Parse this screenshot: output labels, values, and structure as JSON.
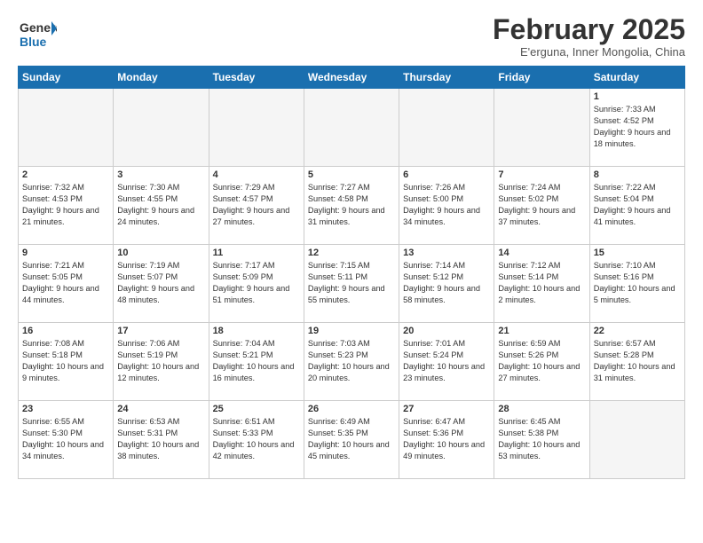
{
  "header": {
    "logo_line1": "General",
    "logo_line2": "Blue",
    "month": "February 2025",
    "location": "E'erguna, Inner Mongolia, China"
  },
  "weekdays": [
    "Sunday",
    "Monday",
    "Tuesday",
    "Wednesday",
    "Thursday",
    "Friday",
    "Saturday"
  ],
  "weeks": [
    [
      {
        "day": "",
        "empty": true
      },
      {
        "day": "",
        "empty": true
      },
      {
        "day": "",
        "empty": true
      },
      {
        "day": "",
        "empty": true
      },
      {
        "day": "",
        "empty": true
      },
      {
        "day": "",
        "empty": true
      },
      {
        "day": "1",
        "sunrise": "7:33 AM",
        "sunset": "4:52 PM",
        "daylight": "9 hours and 18 minutes."
      }
    ],
    [
      {
        "day": "2",
        "sunrise": "7:32 AM",
        "sunset": "4:53 PM",
        "daylight": "9 hours and 21 minutes."
      },
      {
        "day": "3",
        "sunrise": "7:30 AM",
        "sunset": "4:55 PM",
        "daylight": "9 hours and 24 minutes."
      },
      {
        "day": "4",
        "sunrise": "7:29 AM",
        "sunset": "4:57 PM",
        "daylight": "9 hours and 27 minutes."
      },
      {
        "day": "5",
        "sunrise": "7:27 AM",
        "sunset": "4:58 PM",
        "daylight": "9 hours and 31 minutes."
      },
      {
        "day": "6",
        "sunrise": "7:26 AM",
        "sunset": "5:00 PM",
        "daylight": "9 hours and 34 minutes."
      },
      {
        "day": "7",
        "sunrise": "7:24 AM",
        "sunset": "5:02 PM",
        "daylight": "9 hours and 37 minutes."
      },
      {
        "day": "8",
        "sunrise": "7:22 AM",
        "sunset": "5:04 PM",
        "daylight": "9 hours and 41 minutes."
      }
    ],
    [
      {
        "day": "9",
        "sunrise": "7:21 AM",
        "sunset": "5:05 PM",
        "daylight": "9 hours and 44 minutes."
      },
      {
        "day": "10",
        "sunrise": "7:19 AM",
        "sunset": "5:07 PM",
        "daylight": "9 hours and 48 minutes."
      },
      {
        "day": "11",
        "sunrise": "7:17 AM",
        "sunset": "5:09 PM",
        "daylight": "9 hours and 51 minutes."
      },
      {
        "day": "12",
        "sunrise": "7:15 AM",
        "sunset": "5:11 PM",
        "daylight": "9 hours and 55 minutes."
      },
      {
        "day": "13",
        "sunrise": "7:14 AM",
        "sunset": "5:12 PM",
        "daylight": "9 hours and 58 minutes."
      },
      {
        "day": "14",
        "sunrise": "7:12 AM",
        "sunset": "5:14 PM",
        "daylight": "10 hours and 2 minutes."
      },
      {
        "day": "15",
        "sunrise": "7:10 AM",
        "sunset": "5:16 PM",
        "daylight": "10 hours and 5 minutes."
      }
    ],
    [
      {
        "day": "16",
        "sunrise": "7:08 AM",
        "sunset": "5:18 PM",
        "daylight": "10 hours and 9 minutes."
      },
      {
        "day": "17",
        "sunrise": "7:06 AM",
        "sunset": "5:19 PM",
        "daylight": "10 hours and 12 minutes."
      },
      {
        "day": "18",
        "sunrise": "7:04 AM",
        "sunset": "5:21 PM",
        "daylight": "10 hours and 16 minutes."
      },
      {
        "day": "19",
        "sunrise": "7:03 AM",
        "sunset": "5:23 PM",
        "daylight": "10 hours and 20 minutes."
      },
      {
        "day": "20",
        "sunrise": "7:01 AM",
        "sunset": "5:24 PM",
        "daylight": "10 hours and 23 minutes."
      },
      {
        "day": "21",
        "sunrise": "6:59 AM",
        "sunset": "5:26 PM",
        "daylight": "10 hours and 27 minutes."
      },
      {
        "day": "22",
        "sunrise": "6:57 AM",
        "sunset": "5:28 PM",
        "daylight": "10 hours and 31 minutes."
      }
    ],
    [
      {
        "day": "23",
        "sunrise": "6:55 AM",
        "sunset": "5:30 PM",
        "daylight": "10 hours and 34 minutes."
      },
      {
        "day": "24",
        "sunrise": "6:53 AM",
        "sunset": "5:31 PM",
        "daylight": "10 hours and 38 minutes."
      },
      {
        "day": "25",
        "sunrise": "6:51 AM",
        "sunset": "5:33 PM",
        "daylight": "10 hours and 42 minutes."
      },
      {
        "day": "26",
        "sunrise": "6:49 AM",
        "sunset": "5:35 PM",
        "daylight": "10 hours and 45 minutes."
      },
      {
        "day": "27",
        "sunrise": "6:47 AM",
        "sunset": "5:36 PM",
        "daylight": "10 hours and 49 minutes."
      },
      {
        "day": "28",
        "sunrise": "6:45 AM",
        "sunset": "5:38 PM",
        "daylight": "10 hours and 53 minutes."
      },
      {
        "day": "",
        "empty": true
      }
    ]
  ]
}
